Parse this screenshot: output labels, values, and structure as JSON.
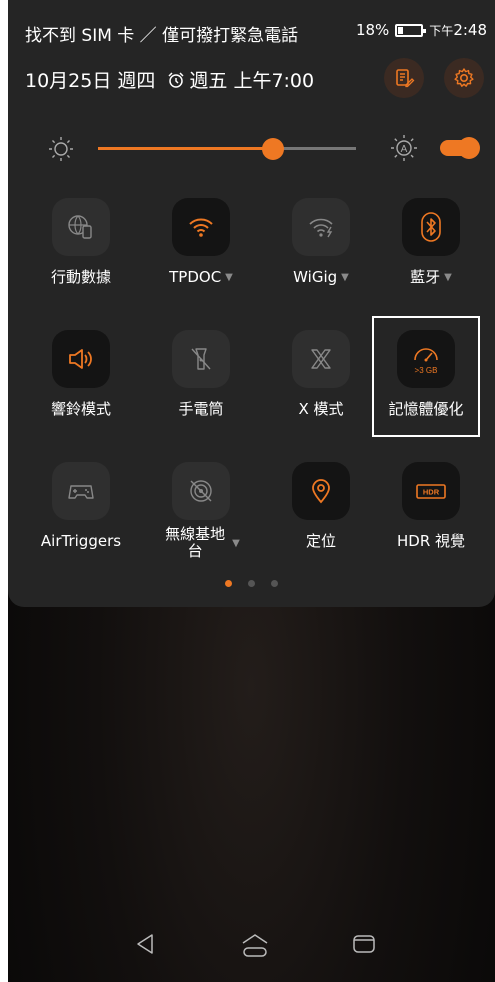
{
  "status_bar": {
    "carrier": "找不到 SIM 卡 ／ 僅可撥打緊急電話",
    "battery_percent": "18%",
    "battery_level": 0.18,
    "ampm": "下午",
    "time": "2:48"
  },
  "header": {
    "date": "10月25日 週四",
    "alarm": "週五 上午7:00"
  },
  "brightness": {
    "level": 0.68,
    "auto_enabled": true
  },
  "tiles": [
    {
      "label": "行動數據",
      "icon": "globe-phone-icon",
      "state": "off",
      "caret": false
    },
    {
      "label": "TPDOC",
      "icon": "wifi-icon",
      "state": "on",
      "caret": true
    },
    {
      "label": "WiGig",
      "icon": "wigig-icon",
      "state": "off",
      "caret": true
    },
    {
      "label": "藍牙",
      "icon": "bluetooth-icon",
      "state": "on",
      "caret": true
    },
    {
      "label": "響鈴模式",
      "icon": "speaker-icon",
      "state": "on",
      "caret": false
    },
    {
      "label": "手電筒",
      "icon": "flashlight-off-icon",
      "state": "off",
      "caret": false
    },
    {
      "label": "X 模式",
      "icon": "x-mode-icon",
      "state": "off",
      "caret": false
    },
    {
      "label": "記憶體優化",
      "icon": "memory-gauge-icon",
      "state": "on",
      "caret": false,
      "badge": ">3 GB"
    },
    {
      "label": "AirTriggers",
      "icon": "gamepad-icon",
      "state": "off",
      "caret": false
    },
    {
      "label": "無線基地台",
      "icon": "hotspot-icon",
      "state": "off",
      "caret": true
    },
    {
      "label": "定位",
      "icon": "location-pin-icon",
      "state": "on",
      "caret": false
    },
    {
      "label": "HDR 視覺",
      "icon": "hdr-icon",
      "state": "on",
      "caret": false,
      "badge": "HDR"
    }
  ],
  "pager": {
    "count": 3,
    "active": 0
  },
  "colors": {
    "accent": "#ee7823",
    "panel": "#252525"
  }
}
